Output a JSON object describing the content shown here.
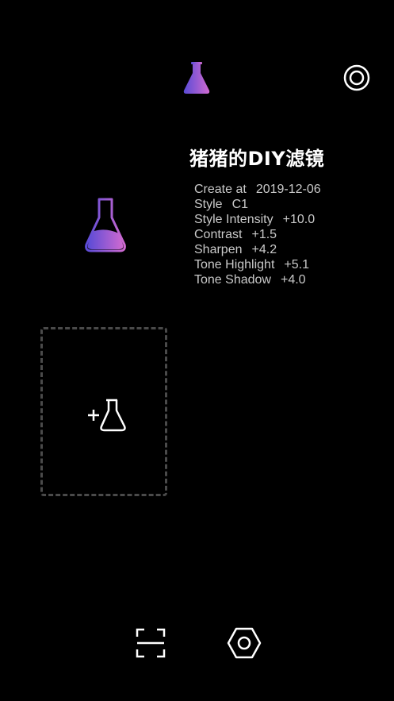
{
  "filter": {
    "title": "猪猪的DIY滤镜",
    "details": [
      {
        "label": "Create at",
        "value": "2019-12-06"
      },
      {
        "label": "Style",
        "value": "C1"
      },
      {
        "label": "Style Intensity",
        "value": "+10.0"
      },
      {
        "label": "Contrast",
        "value": "+1.5"
      },
      {
        "label": "Sharpen",
        "value": "+4.2"
      },
      {
        "label": "Tone Highlight",
        "value": "+5.1"
      },
      {
        "label": "Tone Shadow",
        "value": "+4.0"
      }
    ]
  },
  "icons": {
    "top": "flask-icon",
    "settings": "ring-settings-icon",
    "filter": "flask-icon",
    "add": "add-flask-icon",
    "scan": "scan-icon",
    "hex": "hex-nut-icon"
  },
  "colors": {
    "background": "#000000",
    "gradient_start": "#5a4bd6",
    "gradient_end": "#d06ad0",
    "text": "#ffffff",
    "dashed_border": "#4a4a4a"
  }
}
